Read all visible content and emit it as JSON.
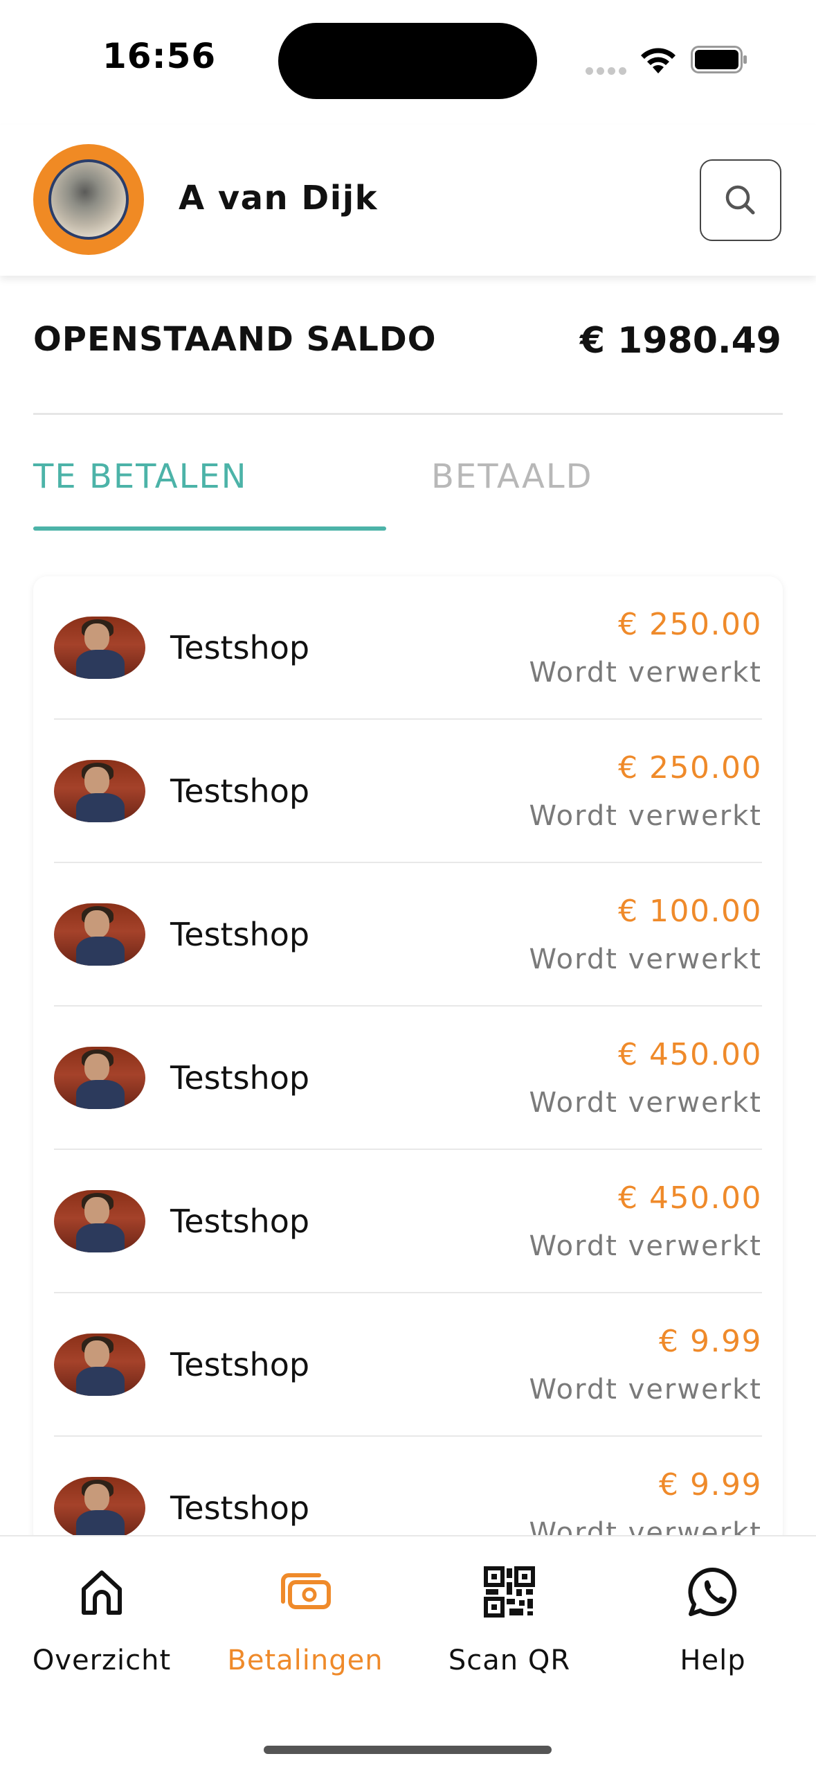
{
  "status_bar": {
    "time": "16:56"
  },
  "header": {
    "user_name": "A van Dijk",
    "search_icon": "search-icon"
  },
  "balance": {
    "label": "OPENSTAAND SALDO",
    "value": "€ 1980.49"
  },
  "tabs": [
    {
      "label": "TE BETALEN",
      "active": true
    },
    {
      "label": "BETAALD",
      "active": false
    }
  ],
  "payments": [
    {
      "shop": "Testshop",
      "amount": "€ 250.00",
      "status": "Wordt verwerkt"
    },
    {
      "shop": "Testshop",
      "amount": "€ 250.00",
      "status": "Wordt verwerkt"
    },
    {
      "shop": "Testshop",
      "amount": "€ 100.00",
      "status": "Wordt verwerkt"
    },
    {
      "shop": "Testshop",
      "amount": "€ 450.00",
      "status": "Wordt verwerkt"
    },
    {
      "shop": "Testshop",
      "amount": "€ 450.00",
      "status": "Wordt verwerkt"
    },
    {
      "shop": "Testshop",
      "amount": "€ 9.99",
      "status": "Wordt verwerkt"
    },
    {
      "shop": "Testshop",
      "amount": "€ 9.99",
      "status": "Wordt verwerkt"
    }
  ],
  "bottom_nav": [
    {
      "label": "Overzicht",
      "icon": "home-icon",
      "active": false
    },
    {
      "label": "Betalingen",
      "icon": "cash-icon",
      "active": true
    },
    {
      "label": "Scan QR",
      "icon": "qr-code-icon",
      "active": false
    },
    {
      "label": "Help",
      "icon": "whatsapp-icon",
      "active": false
    }
  ],
  "colors": {
    "accent_orange": "#ef8a2a",
    "accent_teal": "#4cb3a8",
    "status_gray": "#7a7a7a"
  }
}
